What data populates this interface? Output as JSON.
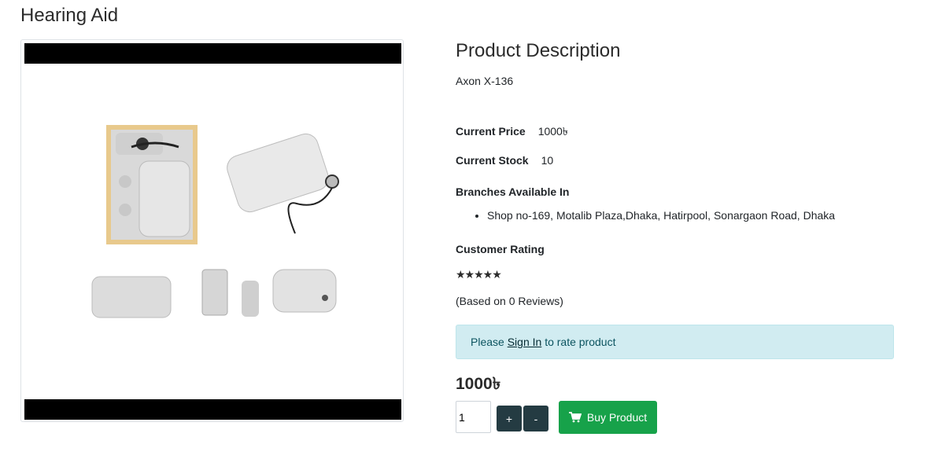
{
  "page": {
    "title": "Hearing Aid"
  },
  "product": {
    "image_alt": "Hearing aid product photo",
    "description_heading": "Product Description",
    "model": "Axon X-136",
    "price_label": "Current Price",
    "price_value": "1000৳",
    "stock_label": "Current Stock",
    "stock_value": "10",
    "branches_label": "Branches Available In",
    "branches": [
      "Shop no-169, Motalib Plaza,Dhaka, Hatirpool, Sonargaon Road, Dhaka"
    ],
    "rating_label": "Customer Rating",
    "rating": 0,
    "rating_max": 5,
    "stars_display": "★★★★★",
    "reviews_text": "(Based on 0 Reviews)",
    "signin_prefix": "Please",
    "signin_link": "Sign In",
    "signin_suffix": "to rate product",
    "big_price": "1000৳"
  },
  "purchase": {
    "quantity": "1",
    "plus_label": "+",
    "minus_label": "-",
    "buy_label": "Buy Product",
    "buy_icon": "cart-icon"
  },
  "colors": {
    "buy": "#17a24a",
    "stepper": "#243b42",
    "alert_bg": "#d1ecf1"
  }
}
